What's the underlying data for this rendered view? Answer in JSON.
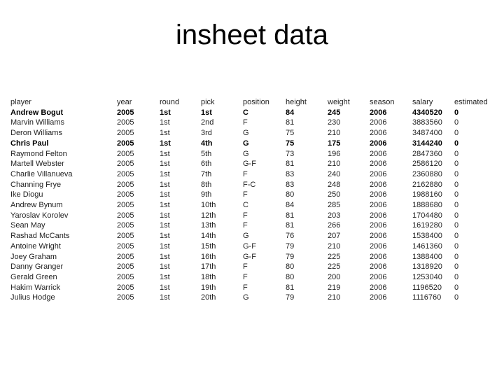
{
  "slide": {
    "title": "insheet data"
  },
  "table": {
    "columns": [
      "player",
      "year",
      "round",
      "pick",
      "position",
      "height",
      "weight",
      "season",
      "salary",
      "estimated"
    ],
    "rows": [
      {
        "bold": true,
        "cells": [
          "Andrew Bogut",
          "2005",
          "1st",
          "1st",
          "C",
          "84",
          "245",
          "2006",
          "4340520",
          "0"
        ]
      },
      {
        "bold": false,
        "cells": [
          "Marvin Williams",
          "2005",
          "1st",
          "2nd",
          "F",
          "81",
          "230",
          "2006",
          "3883560",
          "0"
        ]
      },
      {
        "bold": false,
        "cells": [
          "Deron Williams",
          "2005",
          "1st",
          "3rd",
          "G",
          "75",
          "210",
          "2006",
          "3487400",
          "0"
        ]
      },
      {
        "bold": true,
        "cells": [
          "Chris Paul",
          "2005",
          "1st",
          "4th",
          "G",
          "75",
          "175",
          "2006",
          "3144240",
          "0"
        ]
      },
      {
        "bold": false,
        "cells": [
          "Raymond Felton",
          "2005",
          "1st",
          "5th",
          "G",
          "73",
          "196",
          "2006",
          "2847360",
          "0"
        ]
      },
      {
        "bold": false,
        "cells": [
          "Martell Webster",
          "2005",
          "1st",
          "6th",
          "G-F",
          "81",
          "210",
          "2006",
          "2586120",
          "0"
        ]
      },
      {
        "bold": false,
        "cells": [
          "Charlie Villanueva",
          "2005",
          "1st",
          "7th",
          "F",
          "83",
          "240",
          "2006",
          "2360880",
          "0"
        ]
      },
      {
        "bold": false,
        "cells": [
          "Channing Frye",
          "2005",
          "1st",
          "8th",
          "F-C",
          "83",
          "248",
          "2006",
          "2162880",
          "0"
        ]
      },
      {
        "bold": false,
        "cells": [
          "Ike Diogu",
          "2005",
          "1st",
          "9th",
          "F",
          "80",
          "250",
          "2006",
          "1988160",
          "0"
        ]
      },
      {
        "bold": false,
        "cells": [
          "Andrew Bynum",
          "2005",
          "1st",
          "10th",
          "C",
          "84",
          "285",
          "2006",
          "1888680",
          "0"
        ]
      },
      {
        "bold": false,
        "cells": [
          "Yaroslav Korolev",
          "2005",
          "1st",
          "12th",
          "F",
          "81",
          "203",
          "2006",
          "1704480",
          "0"
        ]
      },
      {
        "bold": false,
        "cells": [
          "Sean May",
          "2005",
          "1st",
          "13th",
          "F",
          "81",
          "266",
          "2006",
          "1619280",
          "0"
        ]
      },
      {
        "bold": false,
        "cells": [
          "Rashad McCants",
          "2005",
          "1st",
          "14th",
          "G",
          "76",
          "207",
          "2006",
          "1538400",
          "0"
        ]
      },
      {
        "bold": false,
        "cells": [
          "Antoine Wright",
          "2005",
          "1st",
          "15th",
          "G-F",
          "79",
          "210",
          "2006",
          "1461360",
          "0"
        ]
      },
      {
        "bold": false,
        "cells": [
          "Joey Graham",
          "2005",
          "1st",
          "16th",
          "G-F",
          "79",
          "225",
          "2006",
          "1388400",
          "0"
        ]
      },
      {
        "bold": false,
        "cells": [
          "Danny Granger",
          "2005",
          "1st",
          "17th",
          "F",
          "80",
          "225",
          "2006",
          "1318920",
          "0"
        ]
      },
      {
        "bold": false,
        "cells": [
          "Gerald Green",
          "2005",
          "1st",
          "18th",
          "F",
          "80",
          "200",
          "2006",
          "1253040",
          "0"
        ]
      },
      {
        "bold": false,
        "cells": [
          "Hakim Warrick",
          "2005",
          "1st",
          "19th",
          "F",
          "81",
          "219",
          "2006",
          "1196520",
          "0"
        ]
      },
      {
        "bold": false,
        "cells": [
          "Julius Hodge",
          "2005",
          "1st",
          "20th",
          "G",
          "79",
          "210",
          "2006",
          "1116760",
          "0"
        ]
      }
    ]
  }
}
